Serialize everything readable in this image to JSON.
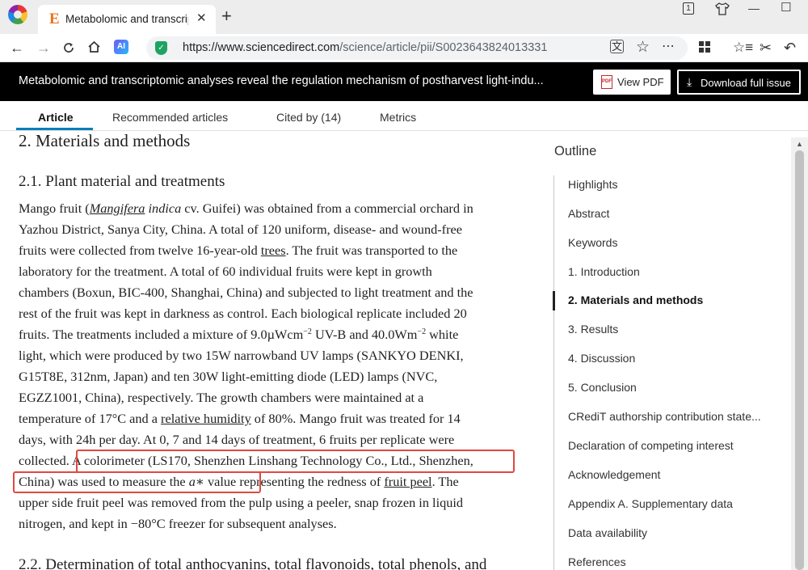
{
  "browser": {
    "tab_title": "Metabolomic and transcriptomic",
    "tab_favicon": "E",
    "tab_close": "✕",
    "new_tab": "+",
    "url_domain": "https://www.sciencedirect.com",
    "url_path": "/science/article/pii/S0023643824013331",
    "ai_label": "AI",
    "controls": {
      "profile": "1",
      "minimize": "—",
      "maximize": "☐"
    }
  },
  "header": {
    "title": "Metabolomic and transcriptomic analyses reveal the regulation mechanism of postharvest light-indu...",
    "view_pdf": "View PDF",
    "download": "Download full issue",
    "pdf_icon_text": "PDF"
  },
  "tabs": [
    {
      "label": "Article",
      "active": true
    },
    {
      "label": "Recommended articles",
      "active": false
    },
    {
      "label": "Cited by (14)",
      "active": false
    },
    {
      "label": "Metrics",
      "active": false
    }
  ],
  "article": {
    "section_heading": "2. Materials and methods",
    "subsection_heading": "2.1. Plant material and treatments",
    "next_heading": "2.2. Determination of total anthocyanins, total flavonoids, total phenols, and",
    "lines": {
      "l1_a": "Mango fruit (",
      "l1_genus": "Mangifera",
      "l1_species": " indica",
      "l1_b": " cv. Guifei) was obtained from a commercial orchard in",
      "l2": "Yazhou District, Sanya City, China. A total of 120 uniform, disease- and wound-free",
      "l3_a": "fruits were collected from twelve 16-year-old ",
      "l3_link": "trees",
      "l3_b": ". The fruit was transported to the",
      "l4": "laboratory for the treatment. A total of 60 individual fruits were kept in growth",
      "l5": "chambers (Boxun, BIC-400, Shanghai, China) and subjected to light treatment and the",
      "l6": "rest of the fruit was kept in darkness as control. Each biological replicate included 20",
      "l7_a": "fruits. The treatments included a mixture of 9.0µWcm",
      "l7_sup1": "−2",
      "l7_b": " UV-B and 40.0Wm",
      "l7_sup2": "−2",
      "l7_c": " white",
      "l8": "light, which were produced by two 15W narrowband UV lamps (SANKYO DENKI,",
      "l9": "G15T8E, 312nm, Japan) and ten 30W light-emitting diode (LED) lamps (NVC,",
      "l10": "EGZZ1001, China), respectively. The growth chambers were maintained at a",
      "l11_a": "temperature of 17°C and a ",
      "l11_link": "relative humidity",
      "l11_b": " of 80%. Mango fruit was treated for 14",
      "l12": "days, with 24h per day. At 0, 7 and 14 days of treatment, 6 fruits per replicate were",
      "l13_a": "collected.",
      "l13_b": " A colorimeter (LS170, Shenzhen Linshang Technology Co., Ltd., Shenzhen,",
      "l14_a": "China) was used to measure the ",
      "l14_var": "a",
      "l14_star": "∗",
      "l14_b": " value",
      "l14_c": " representing the redness of ",
      "l14_link": "fruit peel",
      "l14_d": ". The",
      "l15": "upper side fruit peel was removed from the pulp using a peeler, snap frozen in liquid",
      "l16": "nitrogen, and kept in −80°C freezer for subsequent analyses."
    }
  },
  "outline": {
    "title": "Outline",
    "items": [
      {
        "label": "Highlights",
        "active": false
      },
      {
        "label": "Abstract",
        "active": false
      },
      {
        "label": "Keywords",
        "active": false
      },
      {
        "label": "1. Introduction",
        "active": false
      },
      {
        "label": "2. Materials and methods",
        "active": true
      },
      {
        "label": "3. Results",
        "active": false
      },
      {
        "label": "4. Discussion",
        "active": false
      },
      {
        "label": "5. Conclusion",
        "active": false
      },
      {
        "label": "CRediT authorship contribution state...",
        "active": false
      },
      {
        "label": "Declaration of competing interest",
        "active": false
      },
      {
        "label": "Acknowledgement",
        "active": false
      },
      {
        "label": "Appendix A. Supplementary data",
        "active": false
      },
      {
        "label": "Data availability",
        "active": false
      },
      {
        "label": "References",
        "active": false
      }
    ]
  },
  "colors": {
    "highlight_box": "#e04840",
    "tab_underline": "#0c7dbb",
    "header_bg": "#000000"
  }
}
